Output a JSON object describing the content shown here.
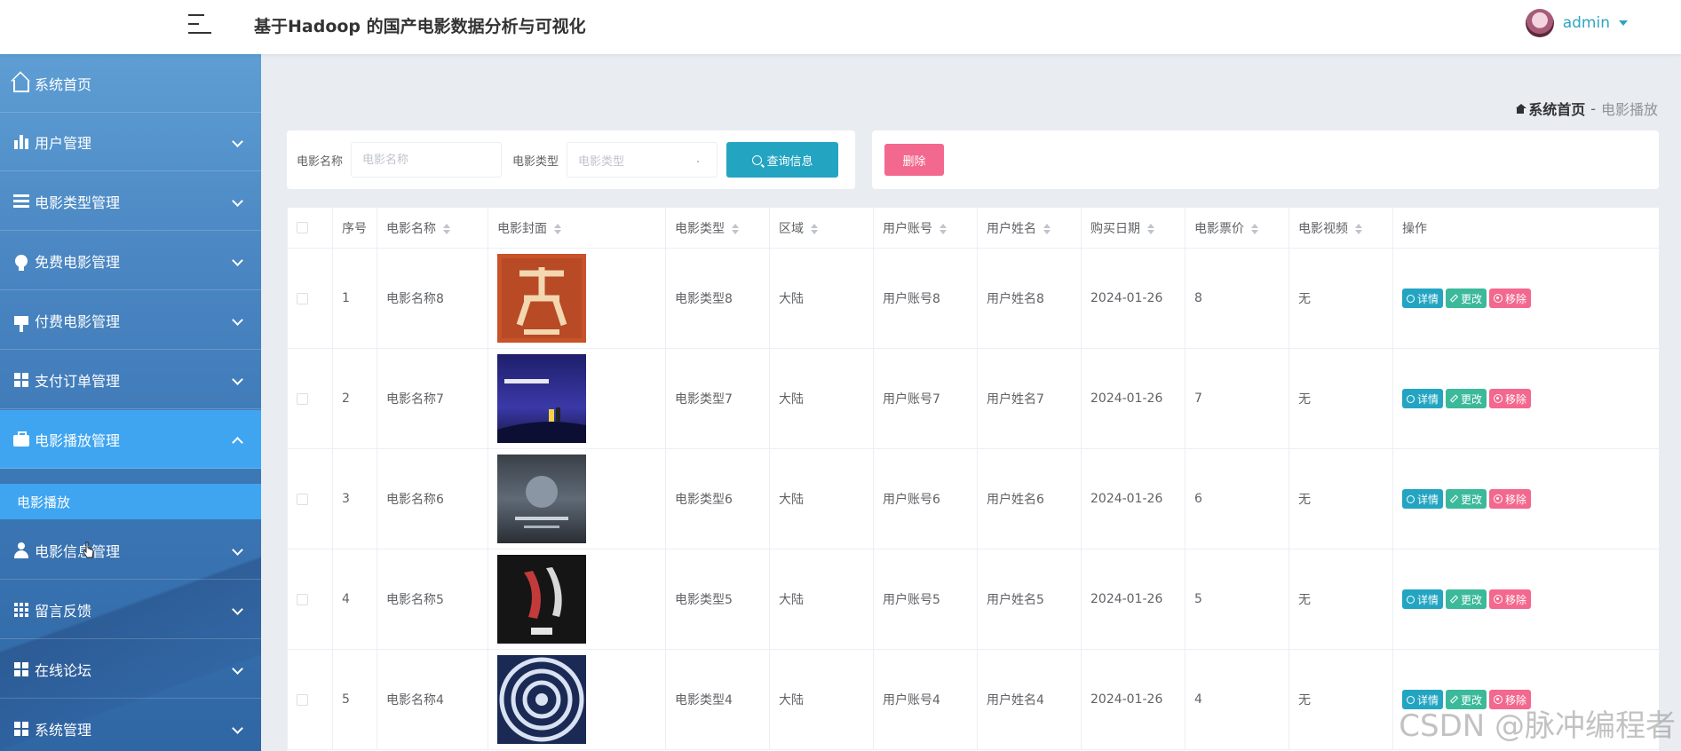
{
  "header": {
    "title": "基于Hadoop 的国产电影数据分析与可视化",
    "user_name": "admin"
  },
  "sidebar": {
    "items": [
      {
        "label": "系统首页",
        "icon": "home-icon"
      },
      {
        "label": "用户管理",
        "icon": "bar-chart-icon"
      },
      {
        "label": "电影类型管理",
        "icon": "list-icon"
      },
      {
        "label": "免费电影管理",
        "icon": "bulb-icon"
      },
      {
        "label": "付费电影管理",
        "icon": "brush-icon"
      },
      {
        "label": "支付订单管理",
        "icon": "grid-icon"
      },
      {
        "label": "电影播放管理",
        "icon": "briefcase-icon",
        "active": true
      },
      {
        "label": "电影信息管理",
        "icon": "user-icon"
      },
      {
        "label": "留言反馈",
        "icon": "apps-icon"
      },
      {
        "label": "在线论坛",
        "icon": "grid-icon"
      },
      {
        "label": "系统管理",
        "icon": "grid-icon"
      }
    ],
    "submenu": {
      "label": "电影播放"
    }
  },
  "breadcrumb": {
    "home": "系统首页",
    "separator": "-",
    "current": "电影播放"
  },
  "search": {
    "name_label": "电影名称",
    "name_placeholder": "电影名称",
    "type_label": "电影类型",
    "type_placeholder": "电影类型",
    "query_button": "查询信息"
  },
  "actions": {
    "delete_button": "删除"
  },
  "table": {
    "columns": [
      "序号",
      "电影名称",
      "电影封面",
      "电影类型",
      "区域",
      "用户账号",
      "用户姓名",
      "购买日期",
      "电影票价",
      "电影视频",
      "操作"
    ],
    "op_labels": {
      "detail": "详情",
      "edit": "更改",
      "remove": "移除"
    },
    "rows": [
      {
        "index": "1",
        "name": "电影名称8",
        "type": "电影类型8",
        "region": "大陆",
        "account": "用户账号8",
        "username": "用户姓名8",
        "date": "2024-01-26",
        "price": "8",
        "video": "无"
      },
      {
        "index": "2",
        "name": "电影名称7",
        "type": "电影类型7",
        "region": "大陆",
        "account": "用户账号7",
        "username": "用户姓名7",
        "date": "2024-01-26",
        "price": "7",
        "video": "无"
      },
      {
        "index": "3",
        "name": "电影名称6",
        "type": "电影类型6",
        "region": "大陆",
        "account": "用户账号6",
        "username": "用户姓名6",
        "date": "2024-01-26",
        "price": "6",
        "video": "无"
      },
      {
        "index": "4",
        "name": "电影名称5",
        "type": "电影类型5",
        "region": "大陆",
        "account": "用户账号5",
        "username": "用户姓名5",
        "date": "2024-01-26",
        "price": "5",
        "video": "无"
      },
      {
        "index": "5",
        "name": "电影名称4",
        "type": "电影类型4",
        "region": "大陆",
        "account": "用户账号4",
        "username": "用户姓名4",
        "date": "2024-01-26",
        "price": "4",
        "video": "无"
      }
    ]
  },
  "watermark": "CSDN @脉冲编程者",
  "colors": {
    "accent": "#23a5c2",
    "edit": "#3bb99a",
    "danger": "#f3688e",
    "sidebar_active": "#3fa5f0"
  }
}
